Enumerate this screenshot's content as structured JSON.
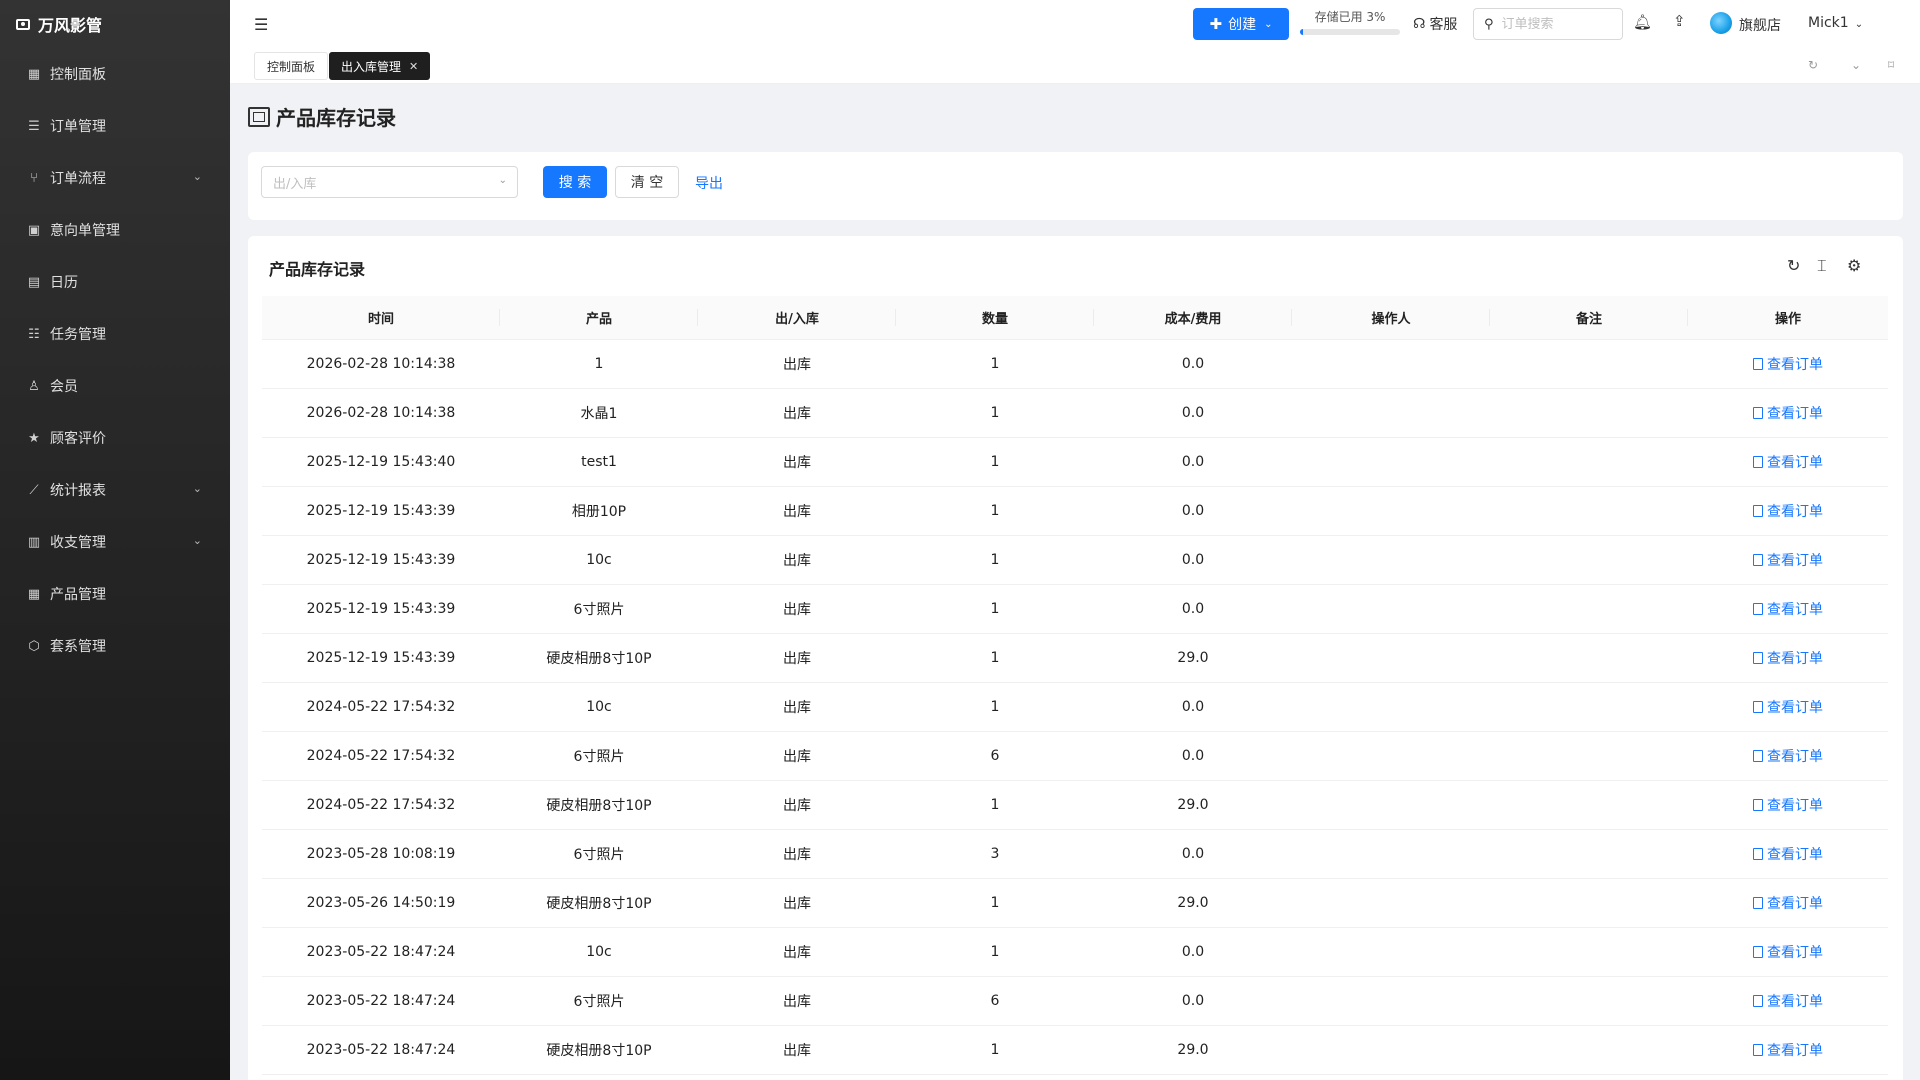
{
  "app": {
    "brand": "万风影管"
  },
  "sidebar": {
    "items": [
      {
        "label": "控制面板",
        "icon": "▦",
        "has_children": false
      },
      {
        "label": "订单管理",
        "icon": "☰",
        "has_children": false
      },
      {
        "label": "订单流程",
        "icon": "⑂",
        "has_children": true
      },
      {
        "label": "意向单管理",
        "icon": "▣",
        "has_children": false
      },
      {
        "label": "日历",
        "icon": "▤",
        "has_children": false
      },
      {
        "label": "任务管理",
        "icon": "☷",
        "has_children": false
      },
      {
        "label": "会员",
        "icon": "♙",
        "has_children": false
      },
      {
        "label": "顾客评价",
        "icon": "★",
        "has_children": false
      },
      {
        "label": "统计报表",
        "icon": "⟋",
        "has_children": true
      },
      {
        "label": "收支管理",
        "icon": "▥",
        "has_children": true
      },
      {
        "label": "产品管理",
        "icon": "▦",
        "has_children": false
      },
      {
        "label": "套系管理",
        "icon": "⬡",
        "has_children": false
      }
    ],
    "chevron": "⌄"
  },
  "header": {
    "create_label": "创建",
    "storage_label": "存储已用 3%",
    "storage_used_fraction": 0.03,
    "service_label": "客服",
    "search_placeholder": "订单搜索",
    "shop_name": "旗舰店",
    "user_name": "Mick1"
  },
  "tabs": [
    {
      "label": "控制面板",
      "active": false
    },
    {
      "label": "出入库管理",
      "active": true
    }
  ],
  "page": {
    "title": "产品库存记录"
  },
  "filter": {
    "select_placeholder": "出/入库",
    "search_label": "搜 索",
    "clear_label": "清 空",
    "export_label": "导出"
  },
  "table": {
    "title": "产品库存记录",
    "columns": [
      "时间",
      "产品",
      "出/入库",
      "数量",
      "成本/费用",
      "操作人",
      "备注",
      "操作"
    ],
    "action_label": "查看订单",
    "rows": [
      [
        "2026-02-28 10:14:38",
        "1",
        "出库",
        "1",
        "0.0",
        "",
        ""
      ],
      [
        "2026-02-28 10:14:38",
        "水晶1",
        "出库",
        "1",
        "0.0",
        "",
        ""
      ],
      [
        "2025-12-19 15:43:40",
        "test1",
        "出库",
        "1",
        "0.0",
        "",
        ""
      ],
      [
        "2025-12-19 15:43:39",
        "相册10P",
        "出库",
        "1",
        "0.0",
        "",
        ""
      ],
      [
        "2025-12-19 15:43:39",
        "10c",
        "出库",
        "1",
        "0.0",
        "",
        ""
      ],
      [
        "2025-12-19 15:43:39",
        "6寸照片",
        "出库",
        "1",
        "0.0",
        "",
        ""
      ],
      [
        "2025-12-19 15:43:39",
        "硬皮相册8寸10P",
        "出库",
        "1",
        "29.0",
        "",
        ""
      ],
      [
        "2024-05-22 17:54:32",
        "10c",
        "出库",
        "1",
        "0.0",
        "",
        ""
      ],
      [
        "2024-05-22 17:54:32",
        "6寸照片",
        "出库",
        "6",
        "0.0",
        "",
        ""
      ],
      [
        "2024-05-22 17:54:32",
        "硬皮相册8寸10P",
        "出库",
        "1",
        "29.0",
        "",
        ""
      ],
      [
        "2023-05-28 10:08:19",
        "6寸照片",
        "出库",
        "3",
        "0.0",
        "",
        ""
      ],
      [
        "2023-05-26 14:50:19",
        "硬皮相册8寸10P",
        "出库",
        "1",
        "29.0",
        "",
        ""
      ],
      [
        "2023-05-22 18:47:24",
        "10c",
        "出库",
        "1",
        "0.0",
        "",
        ""
      ],
      [
        "2023-05-22 18:47:24",
        "6寸照片",
        "出库",
        "6",
        "0.0",
        "",
        ""
      ],
      [
        "2023-05-22 18:47:24",
        "硬皮相册8寸10P",
        "出库",
        "1",
        "29.0",
        "",
        ""
      ]
    ]
  },
  "colors": {
    "primary": "#1677ff",
    "sidebar_bg": "#2a2a2a",
    "active_tab_bg": "#1f1f1f"
  }
}
